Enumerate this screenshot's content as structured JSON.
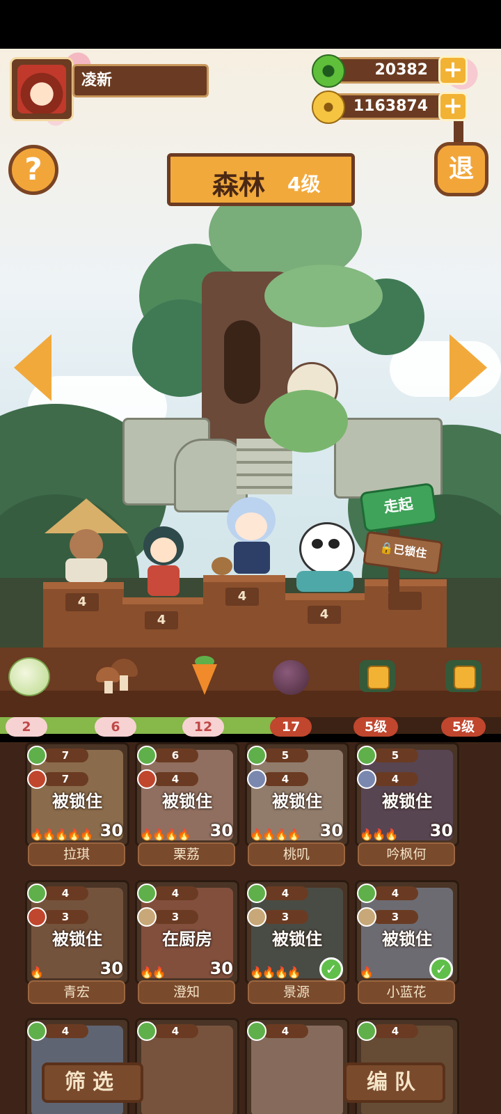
{
  "player": {
    "name": "凌新"
  },
  "resources": {
    "jade": "20382",
    "coins": "1163874"
  },
  "buttons": {
    "help": "?",
    "exit": "退",
    "filter": "筛选",
    "team": "编队"
  },
  "area": {
    "name": "森林",
    "level": "4级"
  },
  "sign": {
    "go": "走起",
    "locked": "已锁住"
  },
  "pedestals": [
    "4",
    "4",
    "4",
    "4"
  ],
  "ingredients": [
    {
      "name": "cabbage-icon",
      "count": "2"
    },
    {
      "name": "mushroom-icon",
      "count": "6"
    },
    {
      "name": "carrot-icon",
      "count": "12"
    },
    {
      "name": "onion-icon",
      "count": "17"
    },
    {
      "name": "locked-food-icon",
      "count": "5级"
    },
    {
      "name": "locked-food-icon",
      "count": "5级"
    }
  ],
  "progress": {
    "fraction": 0.55
  },
  "colors": {
    "accent": "#f2a93b",
    "wood": "#6b3b22",
    "green": "#86b84a"
  },
  "roster": [
    {
      "name": "拉琪",
      "stat1": "7",
      "stat2": "7",
      "status": "被锁住",
      "level": "30",
      "flames": "🔥🔥🔥🔥🔥",
      "check": false
    },
    {
      "name": "栗荔",
      "stat1": "6",
      "stat2": "4",
      "status": "被锁住",
      "level": "30",
      "flames": "🔥🔥🔥🔥",
      "check": false
    },
    {
      "name": "桃叽",
      "stat1": "5",
      "stat2": "4",
      "status": "被锁住",
      "level": "30",
      "flames": "🔥🔥🔥🔥",
      "check": false
    },
    {
      "name": "吟枫何",
      "stat1": "5",
      "stat2": "4",
      "status": "被锁住",
      "level": "30",
      "flames": "🔥🔥🔥",
      "check": false
    },
    {
      "name": "青宏",
      "stat1": "4",
      "stat2": "3",
      "status": "被锁住",
      "level": "30",
      "flames": "🔥",
      "check": false
    },
    {
      "name": "澄知",
      "stat1": "4",
      "stat2": "3",
      "status": "在厨房",
      "level": "30",
      "flames": "🔥🔥",
      "check": false
    },
    {
      "name": "景源",
      "stat1": "4",
      "stat2": "3",
      "status": "被锁住",
      "level": "",
      "flames": "🔥🔥🔥🔥",
      "check": true
    },
    {
      "name": "小蓝花",
      "stat1": "4",
      "stat2": "3",
      "status": "被锁住",
      "level": "",
      "flames": "🔥",
      "check": true
    },
    {
      "name": "",
      "stat1": "4",
      "stat2": "",
      "status": "",
      "level": "",
      "flames": "",
      "check": false
    },
    {
      "name": "",
      "stat1": "4",
      "stat2": "",
      "status": "",
      "level": "",
      "flames": "",
      "check": false
    },
    {
      "name": "",
      "stat1": "4",
      "stat2": "",
      "status": "",
      "level": "",
      "flames": "",
      "check": false
    },
    {
      "name": "",
      "stat1": "4",
      "stat2": "",
      "status": "",
      "level": "",
      "flames": "",
      "check": false
    }
  ]
}
